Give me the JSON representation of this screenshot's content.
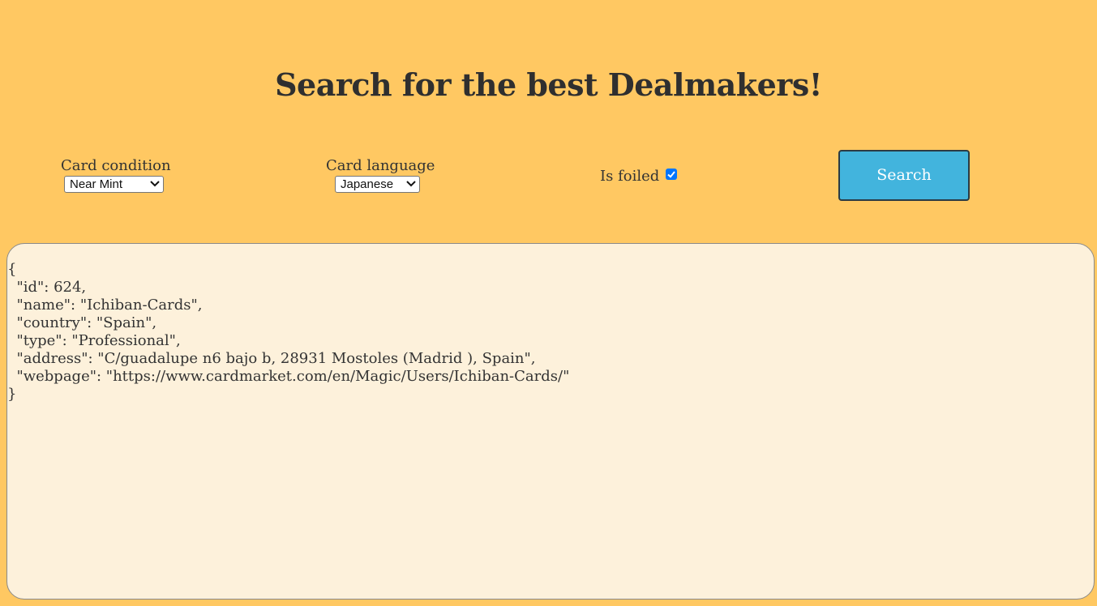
{
  "header": {
    "title": "Search for the best Dealmakers!"
  },
  "filters": {
    "condition": {
      "label": "Card condition",
      "selected": "Near Mint"
    },
    "language": {
      "label": "Card language",
      "selected": "Japanese"
    },
    "foiled": {
      "label": "Is foiled",
      "checked": true
    }
  },
  "actions": {
    "search_label": "Search"
  },
  "result": {
    "lines": [
      "{",
      "  \"id\": 624,",
      "  \"name\": \"Ichiban-Cards\",",
      "  \"country\": \"Spain\",",
      "  \"type\": \"Professional\",",
      "  \"address\": \"C/guadalupe n6 bajo b, 28931 Mostoles (Madrid ), Spain\",",
      "  \"webpage\": \"https://www.cardmarket.com/en/Magic/Users/Ichiban-Cards/\"",
      "}"
    ]
  },
  "colors": {
    "background": "#ffc862",
    "button": "#42b4dd",
    "result_panel": "#fdf1db",
    "checkbox": "#0075ff"
  }
}
